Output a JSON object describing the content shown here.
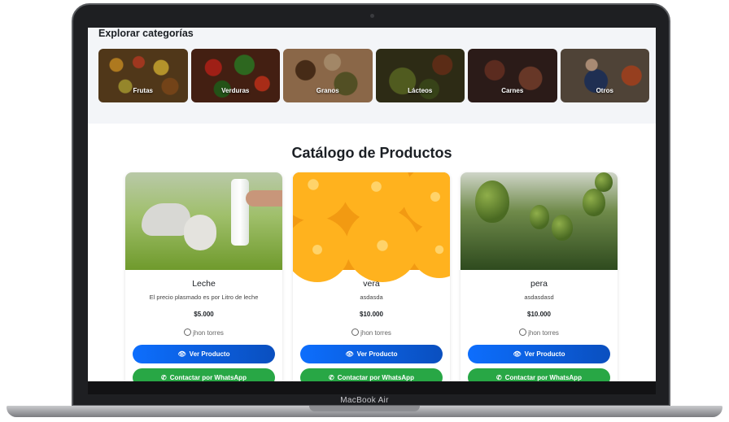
{
  "device_label": "MacBook Air",
  "categories": {
    "title": "Explorar categorías",
    "items": [
      {
        "label": "Frutas"
      },
      {
        "label": "Verduras"
      },
      {
        "label": "Granos"
      },
      {
        "label": "Lácteos"
      },
      {
        "label": "Carnes"
      },
      {
        "label": "Otros"
      }
    ]
  },
  "catalog": {
    "title": "Catálogo de Productos",
    "view_label": "Ver Producto",
    "whatsapp_label": "Contactar por WhatsApp",
    "products": [
      {
        "name": "Leche",
        "description": "El precio plasmado es por Litro de leche",
        "price": "$5.000",
        "seller": "jhon torres"
      },
      {
        "name": "vera",
        "description": "asdasda",
        "price": "$10.000",
        "seller": "jhon torres"
      },
      {
        "name": "pera",
        "description": "asdasdasd",
        "price": "$10.000",
        "seller": "jhon torres"
      }
    ]
  },
  "colors": {
    "primary": "#0d6efd",
    "whatsapp": "#28a745"
  },
  "icons": {
    "view": "eye-icon",
    "whatsapp": "whatsapp-icon",
    "seller": "user-circle-icon"
  }
}
